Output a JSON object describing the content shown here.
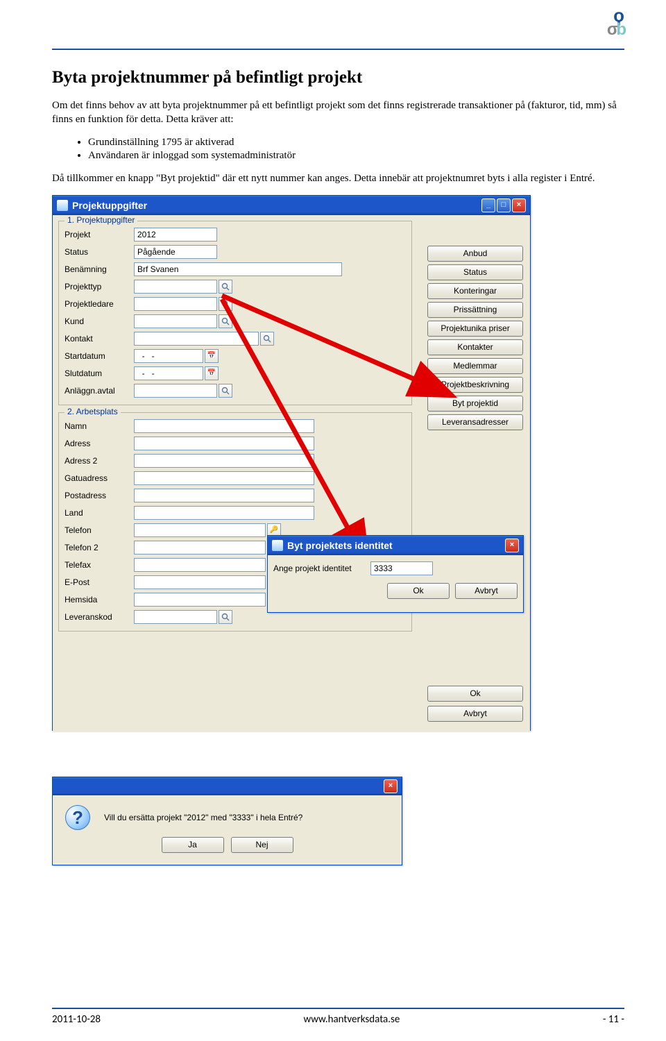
{
  "document": {
    "title": "Byta projektnummer på befintligt projekt",
    "para1": "Om det finns behov av att byta projektnummer på ett befintligt projekt som det finns registrerade transaktioner på (fakturor, tid, mm) så finns en funktion för detta. Detta kräver att:",
    "bullets": [
      "Grundinställning 1795 är aktiverad",
      "Användaren är inloggad som systemadministratör"
    ],
    "para2": "Då tillkommer en knapp \"Byt projektid\" där ett nytt nummer kan anges. Detta innebär att projektnumret byts i alla register i Entré."
  },
  "mainWindow": {
    "title": "Projektuppgifter",
    "fieldset1": "1. Projektuppgifter",
    "fieldset2": "2. Arbetsplats",
    "labels": {
      "projekt": "Projekt",
      "status": "Status",
      "benamning": "Benämning",
      "projekttyp": "Projekttyp",
      "projektledare": "Projektledare",
      "kund": "Kund",
      "kontakt": "Kontakt",
      "startdatum": "Startdatum",
      "slutdatum": "Slutdatum",
      "anlaggn": "Anläggn.avtal",
      "namn": "Namn",
      "adress": "Adress",
      "adress2": "Adress 2",
      "gatuadress": "Gatuadress",
      "postadress": "Postadress",
      "land": "Land",
      "telefon": "Telefon",
      "telefon2": "Telefon 2",
      "telefax": "Telefax",
      "epost": "E-Post",
      "hemsida": "Hemsida",
      "leveranskod": "Leveranskod"
    },
    "values": {
      "projekt": "2012",
      "status": "Pågående",
      "benamning": "Brf Svanen",
      "startdatum": "  -   -",
      "slutdatum": "  -   -"
    },
    "sideButtons": [
      "Anbud",
      "Status",
      "Konteringar",
      "Prissättning",
      "Projektunika priser",
      "Kontakter",
      "Medlemmar",
      "Projektbeskrivning",
      "Byt projektid",
      "Leveransadresser"
    ],
    "okButton": "Ok",
    "cancelButton": "Avbryt"
  },
  "identDialog": {
    "title": "Byt projektets identitet",
    "label": "Ange projekt identitet",
    "value": "3333",
    "ok": "Ok",
    "cancel": "Avbryt"
  },
  "confirmDialog": {
    "message": "Vill du ersätta projekt \"2012\" med \"3333\" i hela Entré?",
    "yes": "Ja",
    "no": "Nej"
  },
  "footer": {
    "date": "2011-10-28",
    "url": "www.hantverksdata.se",
    "page": "- 11 -"
  }
}
